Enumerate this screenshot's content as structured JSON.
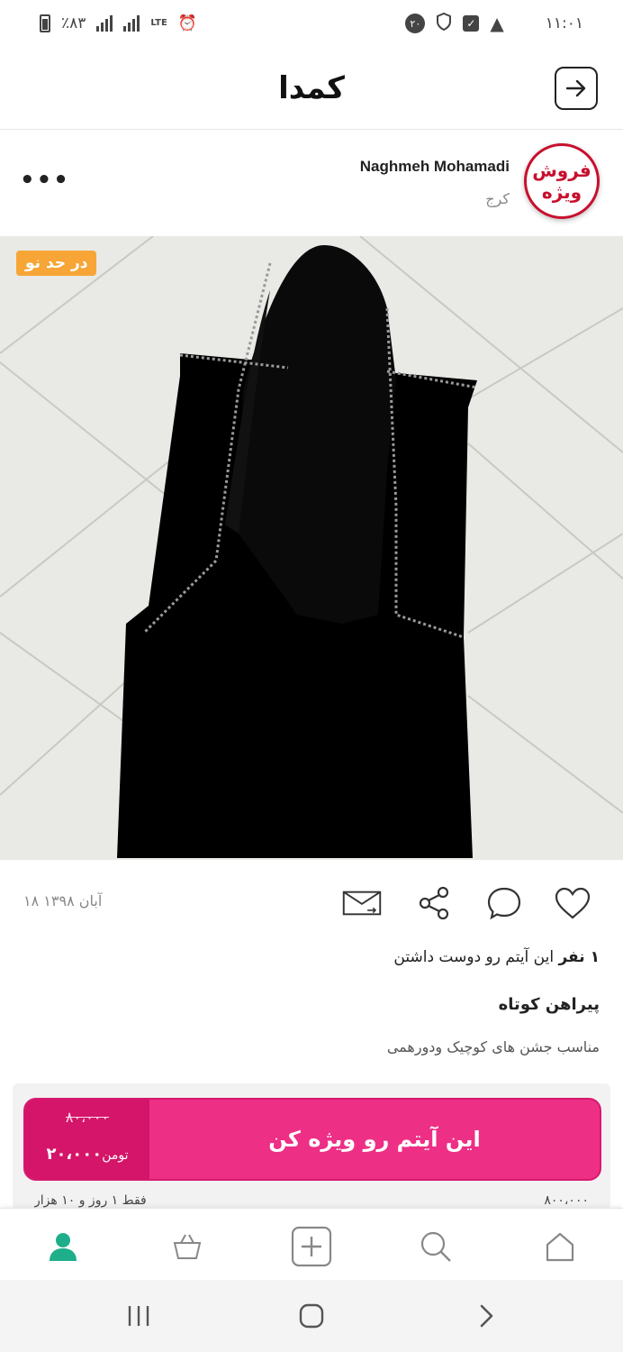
{
  "status_bar": {
    "time": "۱۱:۰۱",
    "notification_count": "۲۰",
    "battery": "٪۸۳",
    "network": "LTE"
  },
  "header": {
    "app_name": "کمدا"
  },
  "seller": {
    "name": "Naghmeh Mohamadi",
    "city": "کرج",
    "avatar_text_line1": "فروش",
    "avatar_text_line2": "ویژه"
  },
  "product": {
    "condition_badge": "در حد نو",
    "date": "۱۸ آبان ۱۳۹۸",
    "likes_count": "۱ نفر",
    "likes_text": "این آیتم رو دوست داشتن",
    "title": "پیراهن کوتاه",
    "description": "مناسب جشن های کوچیک ودورهمی"
  },
  "promote": {
    "label": "این آیتم رو ویژه کن",
    "old_price": "۸۰،۰۰۰",
    "new_price": "۲۰،۰۰۰",
    "currency": "تومن",
    "footer_right": "۸۰۰،۰۰۰",
    "footer_left": "فقط ۱ روز و ۱۰ هزار"
  },
  "colors": {
    "accent": "#ee2f86",
    "accent_dark": "#d41569",
    "badge": "#f7a536",
    "profile_active": "#1fae8a"
  },
  "icons": {
    "heart": "heart-icon",
    "comment": "comment-icon",
    "share": "share-icon",
    "message": "envelope-icon",
    "home": "home-icon",
    "search": "search-icon",
    "add": "plus-square-icon",
    "basket": "basket-icon",
    "profile": "profile-icon"
  }
}
